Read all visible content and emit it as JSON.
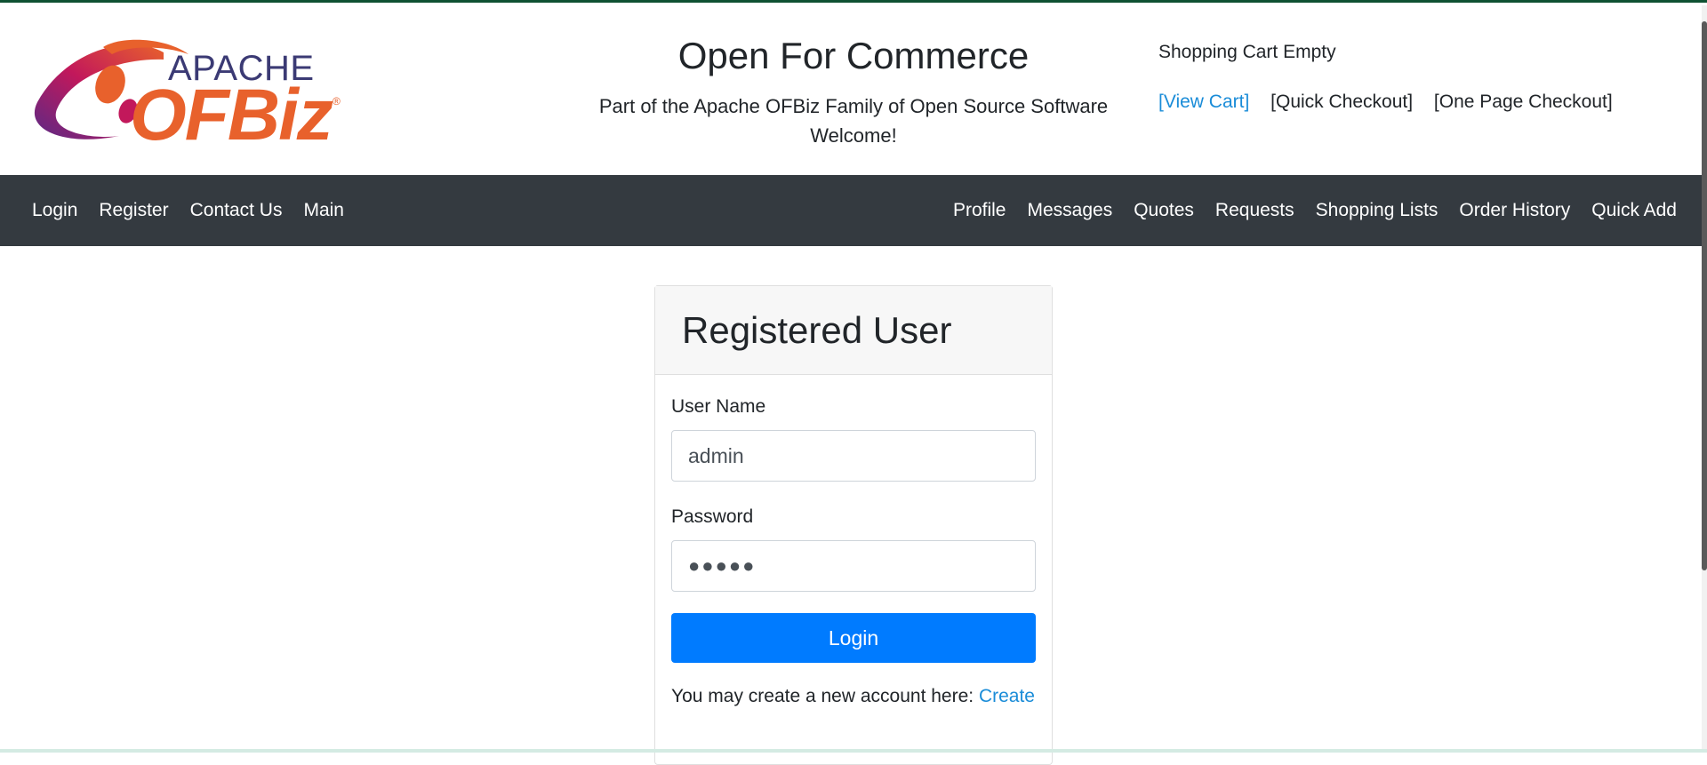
{
  "header": {
    "logo": {
      "apache": "APACHE",
      "ofbiz": "OFBiz",
      "reg": "®"
    },
    "title": "Open For Commerce",
    "subtitle": "Part of the Apache OFBiz Family of Open Source Software",
    "welcome": "Welcome!",
    "cart_status": "Shopping Cart Empty",
    "cart_links": [
      "[View Cart]",
      "[Quick Checkout]",
      "[One Page Checkout]"
    ]
  },
  "nav": {
    "left": [
      "Login",
      "Register",
      "Contact Us",
      "Main"
    ],
    "right": [
      "Profile",
      "Messages",
      "Quotes",
      "Requests",
      "Shopping Lists",
      "Order History",
      "Quick Add"
    ]
  },
  "login_card": {
    "title": "Registered User",
    "username_label": "User Name",
    "username_value": "admin",
    "password_label": "Password",
    "password_value": "●●●●●",
    "login_button": "Login",
    "create_prompt": "You may create a new account here:",
    "create_link": "Create"
  },
  "colors": {
    "navbar_bg": "#343a40",
    "primary": "#007bff",
    "link": "#1a8cd8",
    "logo_orange": "#e8612c",
    "logo_purple": "#3b3a74"
  }
}
